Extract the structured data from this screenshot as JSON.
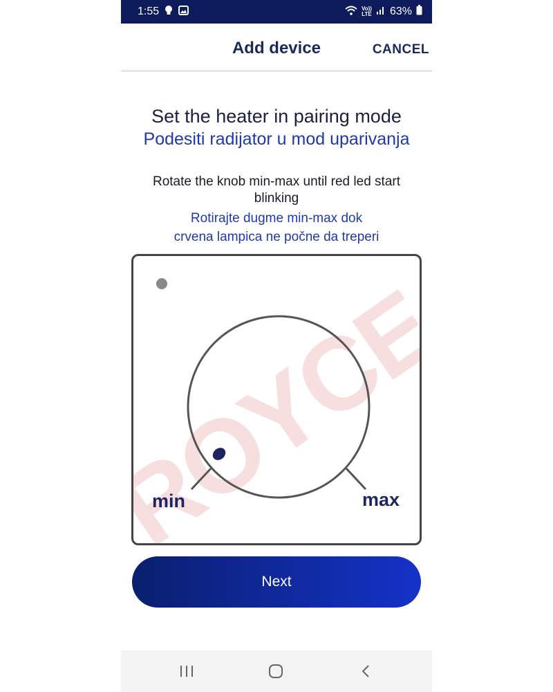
{
  "status_bar": {
    "time": "1:55",
    "lte_top": "Vo))",
    "lte_bottom": "LTE",
    "battery": "63%",
    "icons": [
      "bulb-icon",
      "image-icon",
      "wifi-icon",
      "signal-icon",
      "battery-icon"
    ]
  },
  "header": {
    "title": "Add device",
    "cancel_label": "CANCEL"
  },
  "content": {
    "title_en": "Set the heater in pairing mode",
    "title_sr": "Podesiti radijator u mod uparivanja",
    "instruction_en": "Rotate the knob min-max until red led start blinking",
    "instruction_sr_line1": "Rotirajte dugme min-max dok",
    "instruction_sr_line2": "crvena lampica ne počne da treperi"
  },
  "illustration": {
    "label_min": "min",
    "label_max": "max",
    "watermark": "ROYCE"
  },
  "next_button": {
    "label": "Next"
  },
  "nav_bar": {
    "icons": [
      "recent-apps-icon",
      "home-icon",
      "back-icon"
    ]
  },
  "colors": {
    "status_bar": "#0d1a5c",
    "title_dark": "#1a2040",
    "title_blue": "#1e3aa8",
    "button_start": "#0a1f6e",
    "button_end": "#1432c8"
  }
}
